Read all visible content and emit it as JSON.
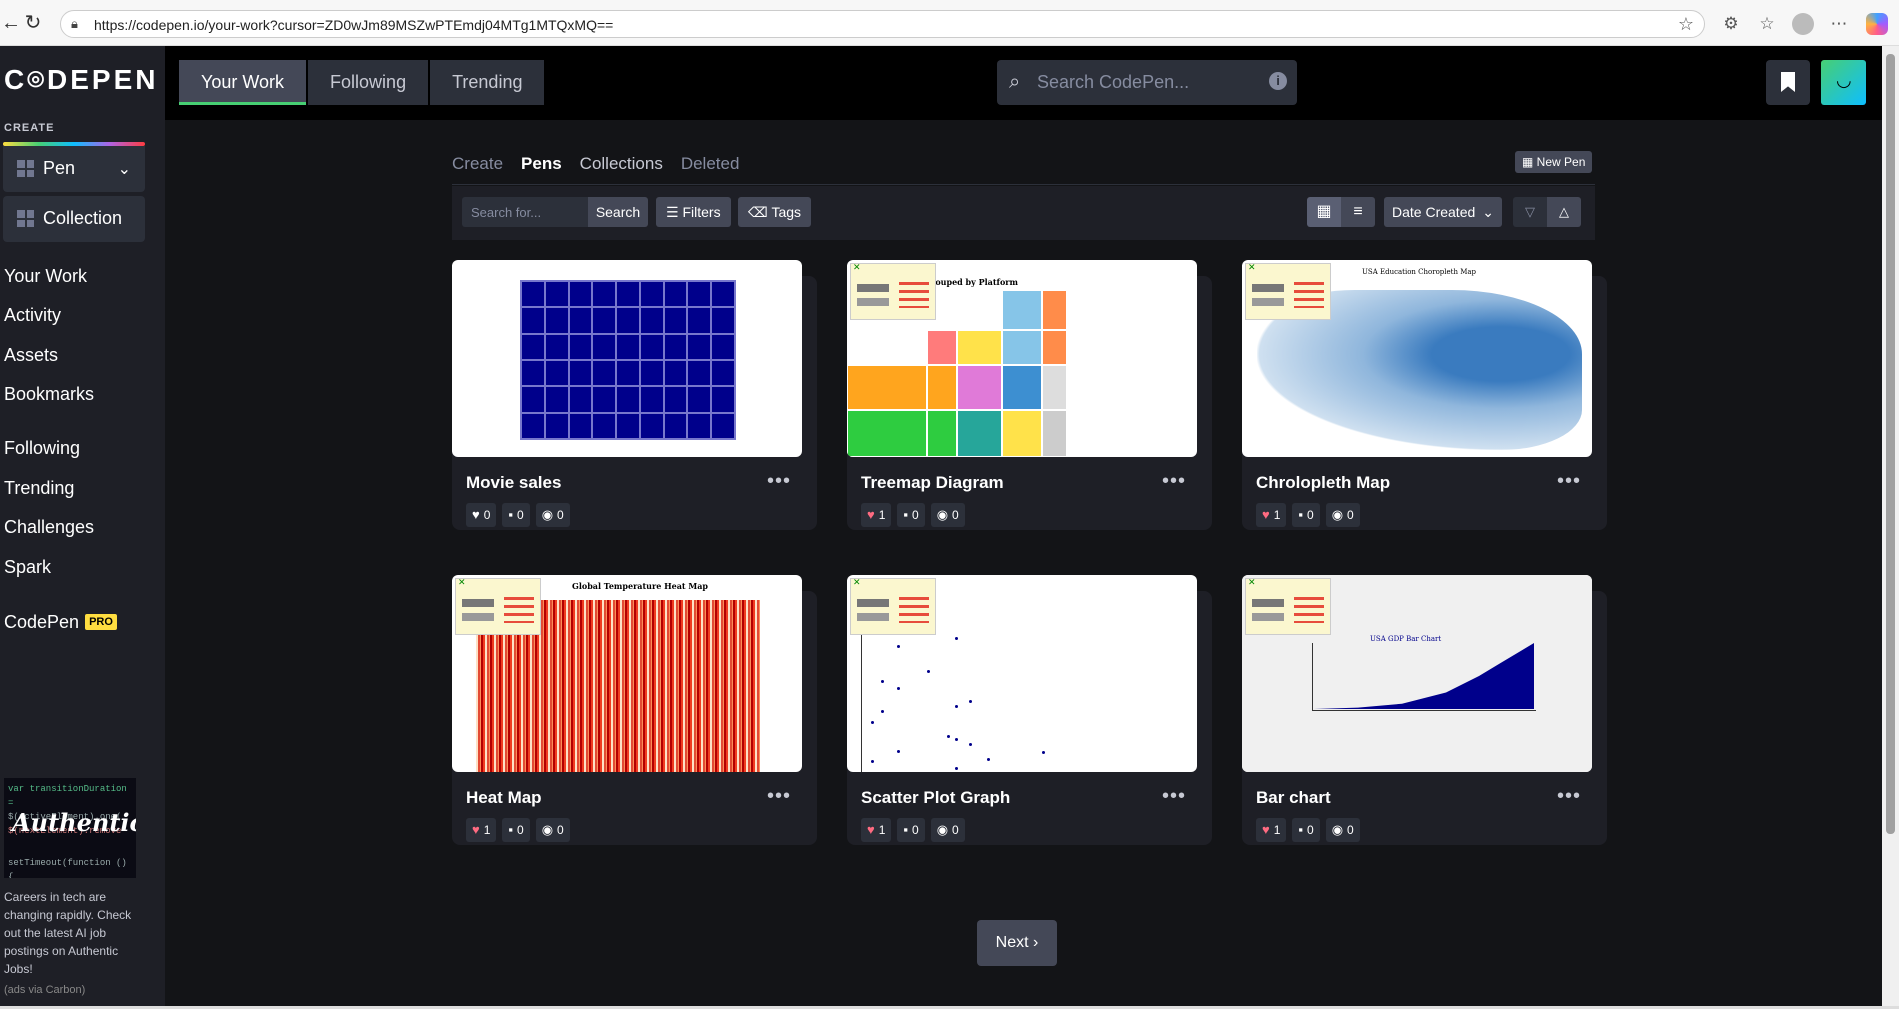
{
  "browser": {
    "url": "https://codepen.io/your-work?cursor=ZD0wJm89MSZwPTEmdj04MTg1MTQxMQ=="
  },
  "sidebar": {
    "logo": "C⌾DEPEN",
    "create_label": "CREATE",
    "create_buttons": [
      {
        "label": "Pen"
      },
      {
        "label": "Collection"
      }
    ],
    "links": [
      "Your Work",
      "Activity",
      "Assets",
      "Bookmarks",
      "Following",
      "Trending",
      "Challenges",
      "Spark"
    ],
    "codepen_pro": {
      "label": "CodePen",
      "badge": "PRO"
    },
    "ad": {
      "image_text": "Authentic",
      "text": "Careers in tech are changing rapidly. Check out the latest AI job postings on Authentic Jobs!",
      "via": "(ads via Carbon)"
    }
  },
  "header": {
    "tabs": [
      "Your Work",
      "Following",
      "Trending"
    ],
    "active_tab": "Your Work",
    "search_placeholder": "Search CodePen..."
  },
  "main": {
    "sub_tabs": [
      "Create",
      "Pens",
      "Collections",
      "Deleted"
    ],
    "active_sub_tab": "Pens",
    "new_pen_label": "New Pen",
    "toolbar": {
      "search_placeholder": "Search for...",
      "search_button": "Search",
      "filters_button": "Filters",
      "tags_button": "Tags",
      "sort_by": "Date Created"
    },
    "pens": [
      {
        "title": "Movie sales",
        "likes": "0",
        "comments": "0",
        "views": "0",
        "liked": false
      },
      {
        "title": "Treemap Diagram",
        "likes": "1",
        "comments": "0",
        "views": "0",
        "liked": true
      },
      {
        "title": "Chrolopleth Map",
        "likes": "1",
        "comments": "0",
        "views": "0",
        "liked": true
      },
      {
        "title": "Heat Map",
        "likes": "1",
        "comments": "0",
        "views": "0",
        "liked": true
      },
      {
        "title": "Scatter Plot Graph",
        "likes": "1",
        "comments": "0",
        "views": "0",
        "liked": true
      },
      {
        "title": "Bar chart",
        "likes": "1",
        "comments": "0",
        "views": "0",
        "liked": true
      }
    ],
    "thumb_texts": {
      "treemap_title": "s Grouped by Platform",
      "choropleth_title": "USA Education Choropleth Map",
      "heatmap_title": "Global Temperature Heat Map",
      "bar_title": "USA GDP Bar Chart"
    },
    "next_label": "Next ›"
  }
}
